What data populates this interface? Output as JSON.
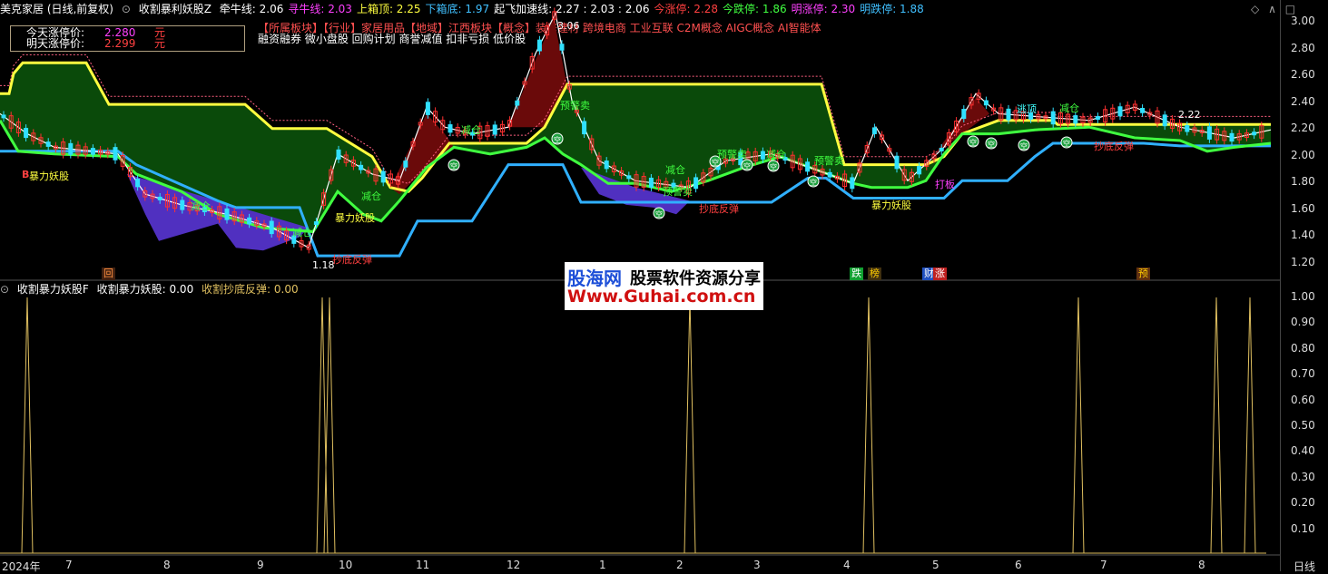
{
  "header": {
    "stock": "美克家居 (日线,前复权)",
    "indicator": "收割暴利妖股Z",
    "items": [
      {
        "label": "牵牛线: 2.06",
        "color": "#ffffff"
      },
      {
        "label": "寻牛线: 2.03",
        "color": "#ff40ff"
      },
      {
        "label": "上箱顶: 2.25",
        "color": "#ffff40"
      },
      {
        "label": "下箱底: 1.97",
        "color": "#40c0ff"
      },
      {
        "label": "起飞加速线: 2.27 : 2.03 : 2.06",
        "color": "#ffffff"
      },
      {
        "label": "今涨停: 2.28",
        "color": "#ff4040"
      },
      {
        "label": "今跌停: 1.86",
        "color": "#40ff40"
      },
      {
        "label": "明涨停: 2.30",
        "color": "#ff40ff"
      },
      {
        "label": "明跌停: 1.88",
        "color": "#40c0ff"
      }
    ]
  },
  "limit_box": {
    "today_label": "今天涨停价:",
    "today_value": "2.280",
    "today_unit": "元",
    "tomorrow_label": "明天涨停价:",
    "tomorrow_value": "2.299",
    "tomorrow_unit": "元"
  },
  "sectors": "【所属板块】【行业】家居用品【地域】江西板块【概念】装修建材 跨境电商 工业互联 C2M概念 AIGC概念 AI智能体",
  "concepts": "融资融券 微小盘股 回购计划 商誉减值 扣非亏损 低价股",
  "lower_header": {
    "indicator": "收割暴力妖股F",
    "v1": "收割暴力妖股: 0.00",
    "v2": "收割抄底反弹: 0.00"
  },
  "price_axis": [
    "3.00",
    "2.80",
    "2.60",
    "2.40",
    "2.20",
    "2.00",
    "1.80",
    "1.60",
    "1.40",
    "1.20"
  ],
  "lower_axis": [
    "1.00",
    "0.90",
    "0.80",
    "0.70",
    "0.60",
    "0.50",
    "0.40",
    "0.30",
    "0.20",
    "0.10"
  ],
  "x_axis": [
    "2024年",
    "7",
    "8",
    "9",
    "10",
    "11",
    "12",
    "1",
    "2",
    "3",
    "4",
    "5",
    "6",
    "7",
    "8"
  ],
  "period_label": "日线",
  "watermark": {
    "brand": "股海网",
    "slogan": "股票软件资源分享",
    "url": "Www.Guhai.com.cn"
  },
  "annotations": {
    "baoli": "暴力妖股",
    "jiancang": "减仓",
    "yujingmai": "预警卖",
    "chaodi": "抄底反弹",
    "daban": "打板",
    "xiaodi": "小熊",
    "taopao": "逃顶",
    "low_price": "1.18",
    "high_price": "3.06",
    "last_price": "2.22",
    "kong": "空",
    "b": "B"
  },
  "tags": [
    {
      "text": "回",
      "color": "#ff9040",
      "bg": "#402010"
    },
    {
      "text": "跌",
      "color": "#ffffff",
      "bg": "#10a030"
    },
    {
      "text": "榜",
      "color": "#ffcc00",
      "bg": "#403010"
    },
    {
      "text": "财",
      "color": "#ffffff",
      "bg": "#2050c0"
    },
    {
      "text": "涨",
      "color": "#ffffff",
      "bg": "#c02020"
    },
    {
      "text": "预",
      "color": "#ffcc00",
      "bg": "#603010"
    }
  ],
  "colors": {
    "box": "#ffff40",
    "bull": "#40ff40",
    "support": "#30b0ff",
    "fill": "#0a4a0a",
    "spike": "#e0c060"
  }
}
